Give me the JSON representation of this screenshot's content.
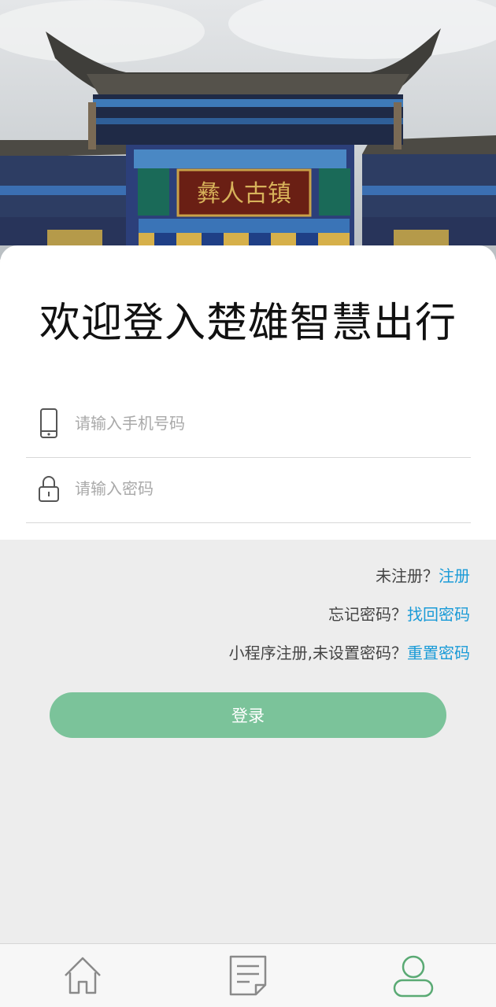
{
  "header": {
    "welcome_title": "欢迎登入楚雄智慧出行"
  },
  "form": {
    "phone": {
      "placeholder": "请输入手机号码",
      "value": ""
    },
    "password": {
      "placeholder": "请输入密码",
      "value": ""
    }
  },
  "links": {
    "register_prompt": "未注册？",
    "register_link": "注册",
    "forgot_prompt": "忘记密码？",
    "forgot_link": "找回密码",
    "reset_prompt": "小程序注册,未设置密码？",
    "reset_link": "重置密码"
  },
  "login_button": {
    "label": "登录"
  },
  "tabbar": {
    "tabs": [
      {
        "icon": "home-icon",
        "active": false
      },
      {
        "icon": "document-icon",
        "active": false
      },
      {
        "icon": "user-icon",
        "active": true
      }
    ]
  },
  "colors": {
    "accent_green": "#7bc39a",
    "link_blue": "#1a9bd7",
    "active_tab": "#5aaa74",
    "inactive_tab": "#8a8a8a"
  },
  "hero": {
    "sign_text": "彝人古镇"
  }
}
